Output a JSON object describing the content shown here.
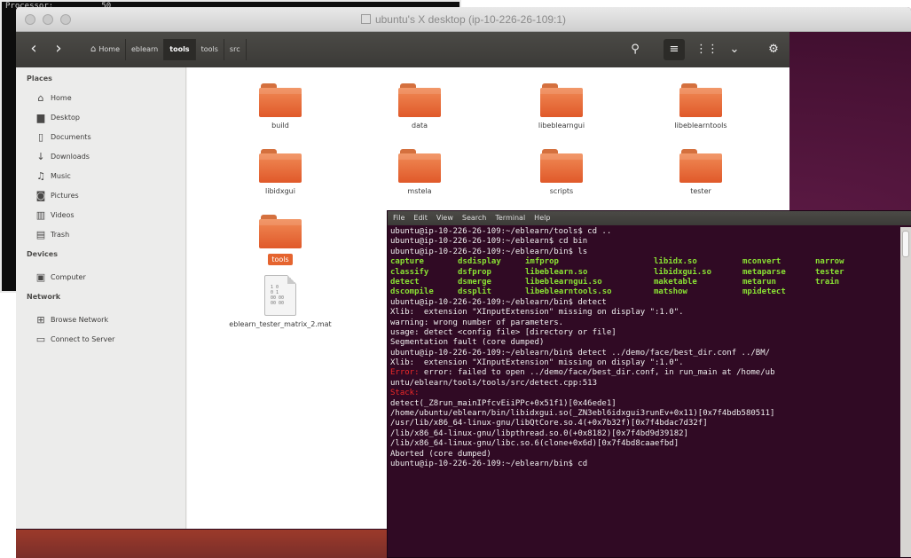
{
  "background_terminal": {
    "lines": [
      "Processor:          50",
      "",
      "",
      "",
      "",
      "",
      "",
      "",
      "",
      "",
      "",
      "",
      "",
      "",
      "",
      "",
      "",
      "",
      "",
      ""
    ]
  },
  "window": {
    "title": "ubuntu's X desktop (ip-10-226-26-109:1)"
  },
  "nautilus": {
    "breadcrumbs": [
      {
        "label": "Home",
        "icon": "home-icon"
      },
      {
        "label": "eblearn"
      },
      {
        "label": "tools"
      },
      {
        "label": "tools"
      },
      {
        "label": "src"
      }
    ],
    "sidebar": {
      "places_heading": "Places",
      "places": [
        {
          "label": "Home",
          "icon": "home-icon"
        },
        {
          "label": "Desktop",
          "icon": "desktop-icon"
        },
        {
          "label": "Documents",
          "icon": "document-icon"
        },
        {
          "label": "Downloads",
          "icon": "download-icon"
        },
        {
          "label": "Music",
          "icon": "music-icon"
        },
        {
          "label": "Pictures",
          "icon": "camera-icon"
        },
        {
          "label": "Videos",
          "icon": "video-icon"
        },
        {
          "label": "Trash",
          "icon": "trash-icon"
        }
      ],
      "devices_heading": "Devices",
      "devices": [
        {
          "label": "Computer",
          "icon": "computer-icon"
        }
      ],
      "network_heading": "Network",
      "network": [
        {
          "label": "Browse Network",
          "icon": "network-icon"
        },
        {
          "label": "Connect to Server",
          "icon": "server-icon"
        }
      ]
    },
    "files": [
      {
        "label": "build",
        "type": "folder"
      },
      {
        "label": "data",
        "type": "folder"
      },
      {
        "label": "libeblearngui",
        "type": "folder"
      },
      {
        "label": "libeblearntools",
        "type": "folder"
      },
      {
        "label": "libidxgui",
        "type": "folder"
      },
      {
        "label": "mstela",
        "type": "folder"
      },
      {
        "label": "scripts",
        "type": "folder"
      },
      {
        "label": "tester",
        "type": "folder"
      },
      {
        "label": "tools",
        "type": "folder",
        "selected": true
      },
      {
        "label": "eblearn_tester_matrix_2.mat",
        "type": "file"
      }
    ]
  },
  "terminal": {
    "menu": [
      "File",
      "Edit",
      "View",
      "Search",
      "Terminal",
      "Help"
    ],
    "line_1": "ubuntu@ip-10-226-26-109:~/eblearn/tools$ cd ..",
    "line_2": "ubuntu@ip-10-226-26-109:~/eblearn$ cd bin",
    "line_3": "ubuntu@ip-10-226-26-109:~/eblearn/bin$ ls",
    "ls_rows": [
      [
        "capture",
        "dsdisplay",
        "imfprop",
        "libidx.so",
        "mconvert",
        "narrow"
      ],
      [
        "classify",
        "dsfprop",
        "libeblearn.so",
        "libidxgui.so",
        "metaparse",
        "tester"
      ],
      [
        "detect",
        "dsmerge",
        "libeblearngui.so",
        "maketable",
        "metarun",
        "train"
      ],
      [
        "dscompile",
        "dssplit",
        "libeblearntools.so",
        "matshow",
        "mpidetect",
        ""
      ]
    ],
    "line_4": "ubuntu@ip-10-226-26-109:~/eblearn/bin$ detect",
    "line_5": "Xlib:  extension \"XInputExtension\" missing on display \":1.0\".",
    "line_6": "warning: wrong number of parameters.",
    "line_7": "usage: detect <config file> [directory or file]",
    "line_8": "Segmentation fault (core dumped)",
    "line_9": "ubuntu@ip-10-226-26-109:~/eblearn/bin$ detect ../demo/face/best_dir.conf ../BM/",
    "line_10": "Xlib:  extension \"XInputExtension\" missing on display \":1.0\".",
    "error_tag": "Error:",
    "line_11": " error: failed to open ../demo/face/best_dir.conf, in run_main at /home/ub",
    "line_12": "untu/eblearn/tools/tools/src/detect.cpp:513",
    "line_13": "Stack:",
    "line_14": "detect(_Z8run_mainIPfcvEiiPPc+0x51f1)[0x46ede1]",
    "line_15": "/home/ubuntu/eblearn/bin/libidxgui.so(_ZN3ebl6idxgui3runEv+0x11)[0x7f4bdb580511]",
    "line_16": "/usr/lib/x86_64-linux-gnu/libQtCore.so.4(+0x7b32f)[0x7f4bdac7d32f]",
    "line_17": "/lib/x86_64-linux-gnu/libpthread.so.0(+0x8182)[0x7f4bd9d39182]",
    "line_18": "/lib/x86_64-linux-gnu/libc.so.6(clone+0x6d)[0x7f4bd8caaefbd]",
    "line_19": "Aborted (core dumped)",
    "line_20": "ubuntu@ip-10-226-26-109:~/eblearn/bin$ cd"
  }
}
